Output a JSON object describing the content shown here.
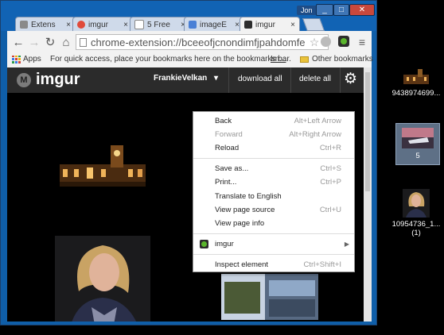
{
  "tabs": [
    {
      "label": "Extens",
      "color": "#8a8a8a"
    },
    {
      "label": "imgur",
      "color": "#e04a3a"
    },
    {
      "label": "5 Free",
      "color": "#ffffff"
    },
    {
      "label": "imageE",
      "color": "#4a80d6"
    },
    {
      "label": "imgur",
      "color": "#2d2d2d",
      "active": true
    }
  ],
  "window": {
    "user": "Jon",
    "close_tab": "×"
  },
  "toolbar": {
    "url": "chrome-extension://bceeofjcnondimfjpahdomfe"
  },
  "bookmarks_bar": {
    "apps": "Apps",
    "hint": "For quick access, place your bookmarks here on the bookmarks bar.",
    "import": "Im...",
    "other": "Other bookmarks"
  },
  "imgur": {
    "logo": "imgur",
    "user": "FrankieVelkan",
    "download_all": "download all",
    "delete_all": "delete all"
  },
  "context_menu": {
    "items": [
      {
        "label": "Back",
        "shortcut": "Alt+Left Arrow",
        "disabled": false
      },
      {
        "label": "Forward",
        "shortcut": "Alt+Right Arrow",
        "disabled": true
      },
      {
        "label": "Reload",
        "shortcut": "Ctrl+R",
        "disabled": false
      },
      {
        "label": "Save as...",
        "shortcut": "Ctrl+S",
        "disabled": false
      },
      {
        "label": "Print...",
        "shortcut": "Ctrl+P",
        "disabled": false
      },
      {
        "label": "Translate to English",
        "shortcut": "",
        "disabled": false
      },
      {
        "label": "View page source",
        "shortcut": "Ctrl+U",
        "disabled": false
      },
      {
        "label": "View page info",
        "shortcut": "",
        "disabled": false
      },
      {
        "label": "imgur",
        "shortcut": "",
        "disabled": false
      },
      {
        "label": "Inspect element",
        "shortcut": "Ctrl+Shift+I",
        "disabled": false
      }
    ]
  },
  "desktop": {
    "icons": [
      {
        "label": "9438974699..."
      },
      {
        "label": "5"
      },
      {
        "label": "10954736_1... (1)"
      }
    ]
  }
}
